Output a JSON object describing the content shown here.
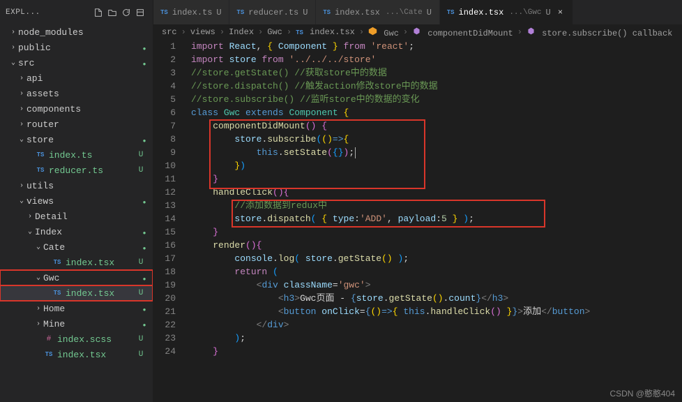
{
  "sidebar": {
    "title": "EXPL...",
    "items": [
      {
        "label": "node_modules",
        "arrow": "›",
        "indent": 1,
        "folder": true
      },
      {
        "label": "public",
        "arrow": "›",
        "indent": 1,
        "folder": true,
        "dot": true
      },
      {
        "label": "src",
        "arrow": "⌄",
        "indent": 1,
        "folder": true,
        "dot": true
      },
      {
        "label": "api",
        "arrow": "›",
        "indent": 2,
        "folder": true
      },
      {
        "label": "assets",
        "arrow": "›",
        "indent": 2,
        "folder": true
      },
      {
        "label": "components",
        "arrow": "›",
        "indent": 2,
        "folder": true
      },
      {
        "label": "router",
        "arrow": "›",
        "indent": 2,
        "folder": true
      },
      {
        "label": "store",
        "arrow": "⌄",
        "indent": 2,
        "folder": true,
        "dot": true
      },
      {
        "label": "index.ts",
        "indent": 3,
        "icon": "TS",
        "status": "U"
      },
      {
        "label": "reducer.ts",
        "indent": 3,
        "icon": "TS",
        "status": "U"
      },
      {
        "label": "utils",
        "arrow": "›",
        "indent": 2,
        "folder": true
      },
      {
        "label": "views",
        "arrow": "⌄",
        "indent": 2,
        "folder": true,
        "dot": true
      },
      {
        "label": "Detail",
        "arrow": "›",
        "indent": 3,
        "folder": true
      },
      {
        "label": "Index",
        "arrow": "⌄",
        "indent": 3,
        "folder": true,
        "dot": true
      },
      {
        "label": "Cate",
        "arrow": "⌄",
        "indent": 4,
        "folder": true,
        "dot": true
      },
      {
        "label": "index.tsx",
        "indent": 5,
        "icon": "TS",
        "status": "U"
      },
      {
        "label": "Gwc",
        "arrow": "⌄",
        "indent": 4,
        "folder": true,
        "dot": true,
        "boxed": true
      },
      {
        "label": "index.tsx",
        "indent": 5,
        "icon": "TS",
        "status": "U",
        "boxed": true,
        "selected": true
      },
      {
        "label": "Home",
        "arrow": "›",
        "indent": 4,
        "folder": true,
        "dot": true
      },
      {
        "label": "Mine",
        "arrow": "›",
        "indent": 4,
        "folder": true,
        "dot": true
      },
      {
        "label": "index.scss",
        "indent": 4,
        "icon": "scss",
        "status": "U"
      },
      {
        "label": "index.tsx",
        "indent": 4,
        "icon": "TS",
        "status": "U"
      }
    ]
  },
  "tabs": [
    {
      "icon": "TS",
      "label": "index.ts",
      "mod": "U"
    },
    {
      "icon": "TS",
      "label": "reducer.ts",
      "mod": "U"
    },
    {
      "icon": "TS",
      "label": "index.tsx",
      "path": "...\\Cate",
      "mod": "U"
    },
    {
      "icon": "TS",
      "label": "index.tsx",
      "path": "...\\Gwc",
      "mod": "U",
      "active": true,
      "close": true
    }
  ],
  "breadcrumb": [
    "src",
    "views",
    "Index",
    "Gwc",
    "index.tsx",
    "Gwc",
    "componentDidMount",
    "store.subscribe() callback"
  ],
  "code_lines": [
    {
      "n": 1,
      "html": "<span class='k'>import</span> <span class='va'>React</span><span class='pu'>,</span> <span class='br'>{</span> <span class='va'>Component</span> <span class='br'>}</span> <span class='k'>from</span> <span class='st'>'react'</span><span class='pu'>;</span>"
    },
    {
      "n": 2,
      "html": "<span class='k'>import</span> <span class='va'>store</span> <span class='k'>from</span> <span class='st'>'../../../store'</span>"
    },
    {
      "n": 3,
      "html": "<span class='cm'>//store.getState() //获取store中的数据</span>"
    },
    {
      "n": 4,
      "html": "<span class='cm'>//store.dispatch() //触发action修改store中的数据</span>"
    },
    {
      "n": 5,
      "html": "<span class='cm'>//store.subscribe() //监听store中的数据的变化</span>"
    },
    {
      "n": 6,
      "html": "<span class='cl'>class</span> <span class='ty'>Gwc</span> <span class='cl'>extends</span> <span class='ty'>Component</span> <span class='br'>{</span>"
    },
    {
      "n": 7,
      "html": "    <span class='fn'>componentDidMount</span><span class='br2'>()</span> <span class='br2'>{</span>"
    },
    {
      "n": 8,
      "html": "        <span class='va'>store</span><span class='pu'>.</span><span class='fn'>subscribe</span><span class='br3'>(</span><span class='br'>()</span><span class='cl'>=&gt;</span><span class='br'>{</span>"
    },
    {
      "n": 9,
      "html": "            <span class='cl'>this</span><span class='pu'>.</span><span class='fn'>setState</span><span class='br2'>(</span><span class='br3'>{}</span><span class='br2'>)</span><span class='pu'>;</span><span class='cursor'></span>"
    },
    {
      "n": 10,
      "html": "        <span class='br'>}</span><span class='br3'>)</span>"
    },
    {
      "n": 11,
      "html": "    <span class='br2'>}</span>"
    },
    {
      "n": 12,
      "html": "    <span class='fn'>handleClick</span><span class='br2'>()</span><span class='br2'>{</span>"
    },
    {
      "n": 13,
      "html": "        <span class='cm'>//添加数据到redux中</span>"
    },
    {
      "n": 14,
      "html": "        <span class='va'>store</span><span class='pu'>.</span><span class='fn'>dispatch</span><span class='br3'>(</span> <span class='br'>{</span> <span class='va'>type</span><span class='pu'>:</span><span class='st'>'ADD'</span><span class='pu'>,</span> <span class='va'>payload</span><span class='pu'>:</span><span class='nu'>5</span> <span class='br'>}</span> <span class='br3'>)</span><span class='pu'>;</span>"
    },
    {
      "n": 15,
      "html": "    <span class='br2'>}</span>"
    },
    {
      "n": 16,
      "html": "    <span class='fn'>render</span><span class='br2'>()</span><span class='br2'>{</span>"
    },
    {
      "n": 17,
      "html": "        <span class='va'>console</span><span class='pu'>.</span><span class='fn'>log</span><span class='br3'>(</span> <span class='va'>store</span><span class='pu'>.</span><span class='fn'>getState</span><span class='br'>()</span> <span class='br3'>)</span><span class='pu'>;</span>"
    },
    {
      "n": 18,
      "html": "        <span class='k'>return</span> <span class='br3'>(</span>"
    },
    {
      "n": 19,
      "html": "            <span class='tg'>&lt;</span><span class='cl'>div</span> <span class='va'>className</span><span class='pu'>=</span><span class='st'>'gwc'</span><span class='tg'>&gt;</span>"
    },
    {
      "n": 20,
      "html": "                <span class='tg'>&lt;</span><span class='cl'>h3</span><span class='tg'>&gt;</span><span class='pu'>Gwc页面 - </span><span class='cl'>{</span><span class='va'>store</span><span class='pu'>.</span><span class='fn'>getState</span><span class='br'>()</span><span class='pu'>.</span><span class='va'>count</span><span class='cl'>}</span><span class='tg'>&lt;/</span><span class='cl'>h3</span><span class='tg'>&gt;</span>"
    },
    {
      "n": 21,
      "html": "                <span class='tg'>&lt;</span><span class='cl'>button</span> <span class='va'>onClick</span><span class='pu'>=</span><span class='cl'>{</span><span class='br'>()</span><span class='cl'>=&gt;</span><span class='br'>{</span> <span class='cl'>this</span><span class='pu'>.</span><span class='fn'>handleClick</span><span class='br2'>()</span> <span class='br'>}</span><span class='cl'>}</span><span class='tg'>&gt;</span><span class='pu'>添加</span><span class='tg'>&lt;/</span><span class='cl'>button</span><span class='tg'>&gt;</span>"
    },
    {
      "n": 22,
      "html": "            <span class='tg'>&lt;/</span><span class='cl'>div</span><span class='tg'>&gt;</span>"
    },
    {
      "n": 23,
      "html": "        <span class='br3'>)</span><span class='pu'>;</span>"
    },
    {
      "n": 24,
      "html": "    <span class='br2'>}</span>"
    }
  ],
  "watermark": "CSDN @憨憨404"
}
